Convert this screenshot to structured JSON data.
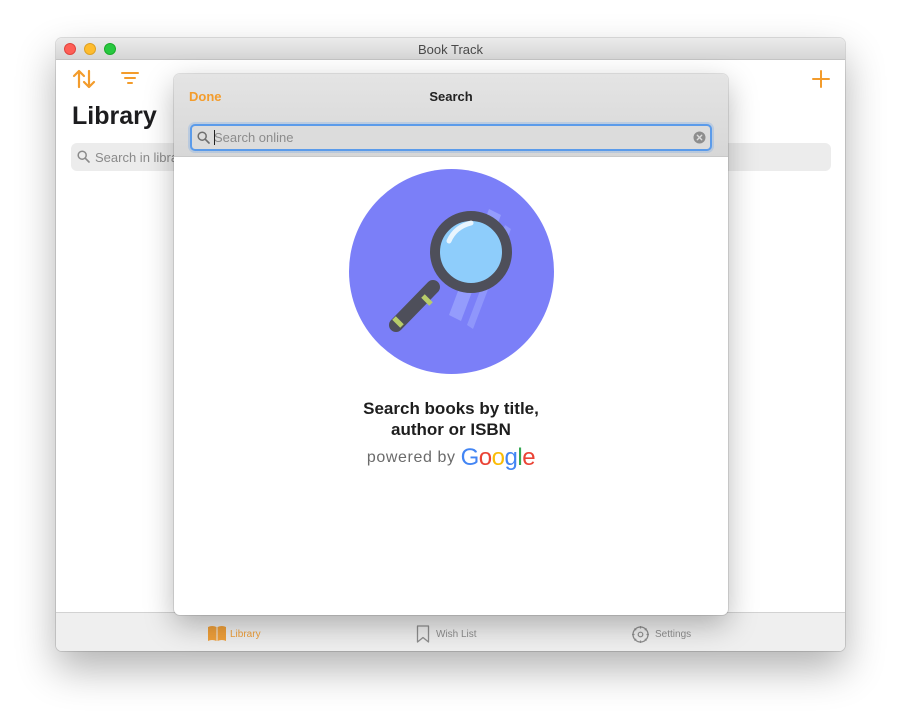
{
  "window": {
    "title": "Book Track"
  },
  "library": {
    "heading": "Library",
    "search_placeholder": "Search in library"
  },
  "icons": {
    "sort": "sort-arrows-icon",
    "filter": "filter-lines-icon",
    "add": "plus-icon",
    "search": "magnifier-icon",
    "clear": "clear-circle-icon",
    "illustration": "magnifying-glass-icon"
  },
  "sheet": {
    "done_label": "Done",
    "title": "Search",
    "search_placeholder": "Search online",
    "search_value": "",
    "empty_line1": "Search books by title,",
    "empty_line2": "author or ISBN",
    "powered_by": "powered by",
    "google": {
      "G": "G",
      "o1": "o",
      "o2": "o",
      "g": "g",
      "l": "l",
      "e": "e"
    }
  },
  "tabs": [
    {
      "label": "Library",
      "icon": "book-open-icon",
      "selected": true
    },
    {
      "label": "Wish List",
      "icon": "bookmark-icon",
      "selected": false
    },
    {
      "label": "Settings",
      "icon": "gear-icon",
      "selected": false
    }
  ],
  "colors": {
    "accent": "#f39c2c",
    "focus_ring": "#5b9bea",
    "illustration_bg": "#7b7ff8",
    "traffic_close": "#fe5f57",
    "traffic_min": "#febc2e",
    "traffic_max": "#28c840"
  }
}
